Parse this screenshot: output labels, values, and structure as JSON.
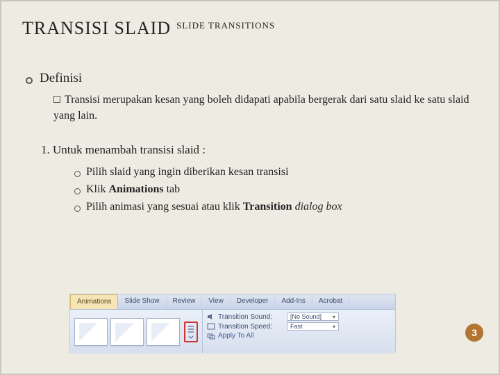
{
  "title": {
    "main": "TRANSISI SLAID",
    "sup": "SLIDE TRANSITIONS"
  },
  "definition": {
    "heading": "Definisi",
    "body_prefix": "Transisi merupakan kesan yang boleh didapati apabila bergerak dari satu slaid ke satu slaid yang lain."
  },
  "steps": {
    "heading": "1. Untuk menambah transisi slaid :",
    "items": [
      {
        "pre": "Pilih slaid yang ingin diberikan kesan transisi"
      },
      {
        "pre": "Klik ",
        "bold": "Animations",
        "post": " tab"
      },
      {
        "pre": "Pilih animasi yang sesuai atau klik ",
        "bold": "Transition",
        "italic": " dialog box"
      }
    ]
  },
  "ribbon": {
    "tabs": [
      "Animations",
      "Slide Show",
      "Review",
      "View",
      "Developer",
      "Add-Ins",
      "Acrobat"
    ],
    "options": {
      "sound_label": "Transition Sound:",
      "sound_value": "[No Sound]",
      "speed_label": "Transition Speed:",
      "speed_value": "Fast",
      "apply_all": "Apply To All"
    }
  },
  "page_number": "3"
}
